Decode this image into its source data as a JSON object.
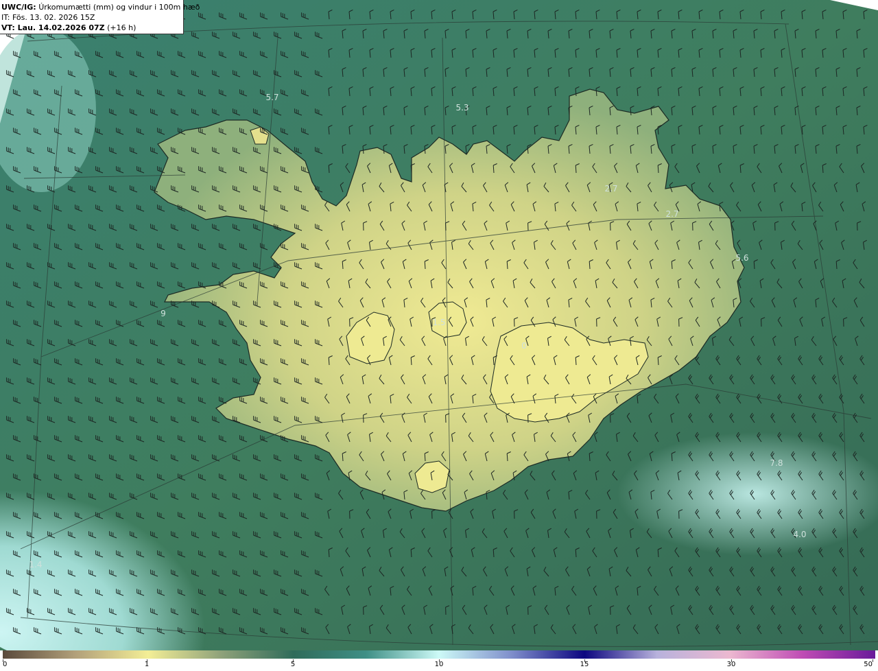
{
  "header": {
    "model": "UWC/IG:",
    "title": "Úrkomumætti (mm) og vindur i 100m hæð",
    "initial_time": "IT: Fös. 13. 02. 2026 15Z",
    "valid_prefix": "VT: Lau. 14.02.2026 07Z",
    "valid_suffix": "(+16 h)"
  },
  "map_labels": [
    {
      "text": "5.7"
    },
    {
      "text": "5.3"
    },
    {
      "text": "2.7"
    },
    {
      "text": "2.7"
    },
    {
      "text": "5.6"
    },
    {
      "text": "1.5"
    },
    {
      "text": "0"
    },
    {
      "text": "7.8"
    },
    {
      "text": "4.0"
    },
    {
      "text": "1.4"
    },
    {
      "text": "9"
    }
  ],
  "colorbar": {
    "ticks": [
      "0",
      "1",
      "5",
      "10",
      "15",
      "30",
      "50"
    ],
    "colors": {
      "c0": "#5a4a3c",
      "c1": "#f3ee96",
      "c5": "#2f6b5a",
      "c10": "#cdfaf7",
      "c15": "#0c0680",
      "c30": "#ecb8d0",
      "c50": "#6a1a9a"
    }
  },
  "colors": {
    "sea_green": "#3a7a62",
    "land_yellow": "#e6e38f",
    "coast_line": "#1c2a24",
    "barb": "#1c2522",
    "cyan_area": "#bde8e4"
  }
}
